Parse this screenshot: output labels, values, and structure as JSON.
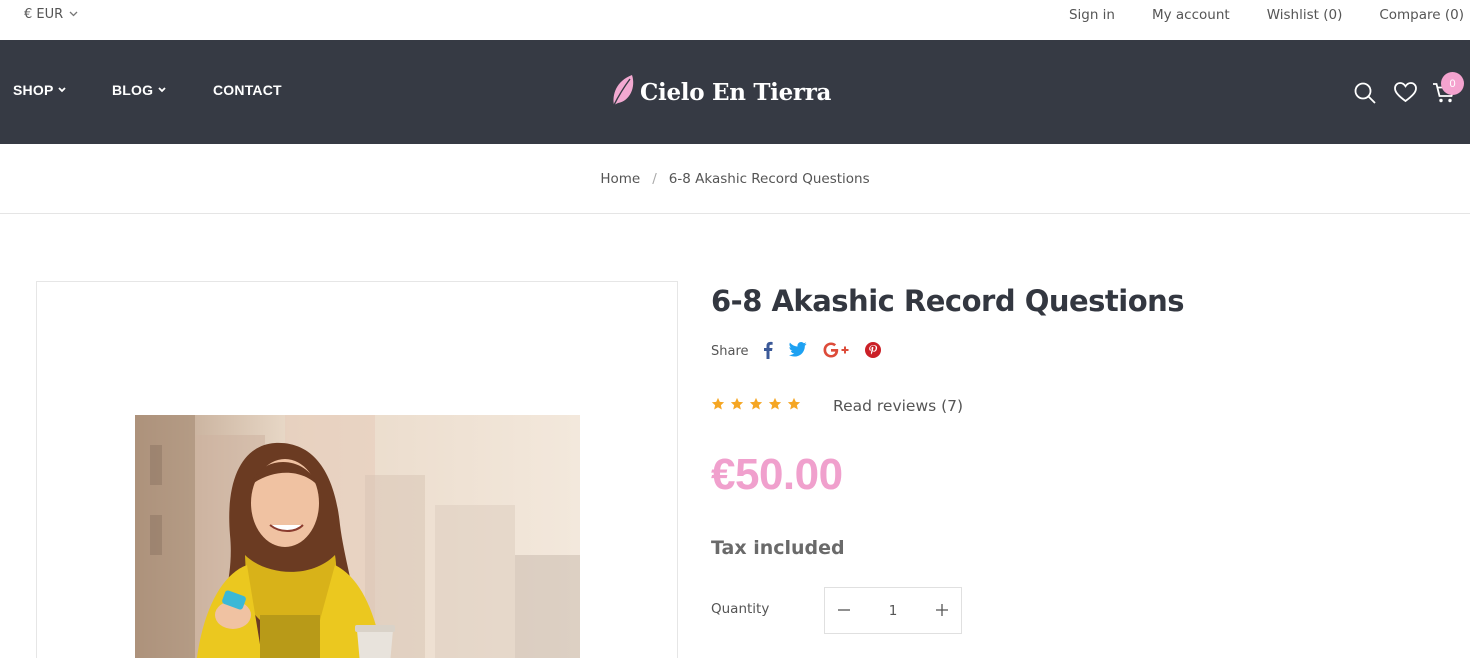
{
  "topbar": {
    "currency": "€ EUR",
    "links": {
      "sign_in": "Sign in",
      "my_account": "My account",
      "wishlist": "Wishlist (0)",
      "compare": "Compare (0)"
    }
  },
  "nav": {
    "menu": {
      "shop": "SHOP",
      "blog": "BLOG",
      "contact": "CONTACT"
    },
    "logo_text": "Cielo En Tierra",
    "cart_count": "0"
  },
  "breadcrumb": {
    "home": "Home",
    "separator": "/",
    "current": "6-8 Akashic Record Questions"
  },
  "product": {
    "title": "6-8 Akashic Record Questions",
    "share_label": "Share",
    "rating_stars": 5,
    "read_reviews": "Read reviews (7)",
    "price": "€50.00",
    "tax_note": "Tax included",
    "quantity_label": "Quantity",
    "quantity_value": "1"
  },
  "colors": {
    "nav_bg": "#363a44",
    "accent_pink": "#f0a0cd",
    "star": "#f5a623",
    "facebook": "#3b5998",
    "twitter": "#1da1f2",
    "google_plus": "#dd4b39",
    "pinterest": "#cb2027"
  },
  "icons": {
    "currency_dropdown": "chevron-down-icon",
    "search": "search-icon",
    "wishlist": "heart-icon",
    "cart": "cart-icon",
    "logo": "leaf-icon"
  }
}
